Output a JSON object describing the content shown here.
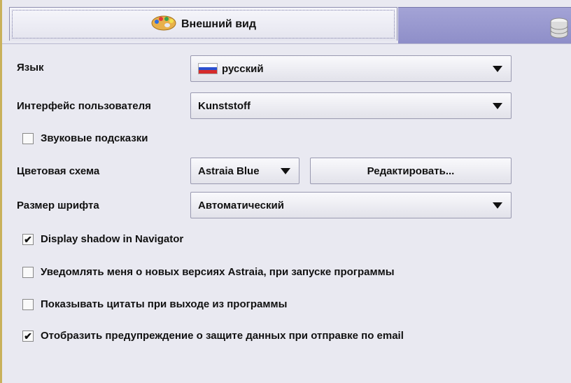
{
  "tabs": {
    "active_label": "Внешний вид",
    "active_icon": "palette-icon",
    "inactive_icon": "database-icon"
  },
  "form": {
    "language_label": "Язык",
    "language_value": "русский",
    "ui_label": "Интерфейс пользователя",
    "ui_value": "Kunststoff",
    "sound_hints_label": "Звуковые подсказки",
    "sound_hints_checked": false,
    "color_scheme_label": "Цветовая схема",
    "color_scheme_value": "Astraia Blue",
    "edit_button_label": "Редактировать...",
    "font_size_label": "Размер шрифта",
    "font_size_value": "Автоматический",
    "checks": [
      {
        "label": "Display shadow in Navigator",
        "checked": true
      },
      {
        "label": "Уведомлять меня о  новых версиях Astraia, при запуске программы",
        "checked": false
      },
      {
        "label": "Показывать цитаты при выходе из программы",
        "checked": false
      },
      {
        "label": "Отобразить предупреждение о защите данных при отправке по email",
        "checked": true
      }
    ]
  },
  "colors": {
    "accent_tab": "#9a9ad0",
    "panel_bg": "#e9e9f1"
  }
}
